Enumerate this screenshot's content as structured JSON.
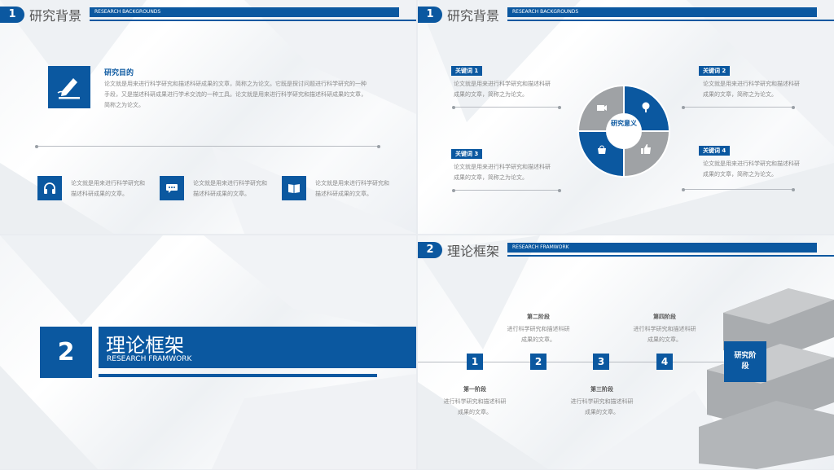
{
  "colors": {
    "accent": "#0b58a0",
    "gray": "#9fa2a5"
  },
  "slide1": {
    "num": "1",
    "title": "研究背景",
    "banner": "RESEARCH BACKGROUNDS",
    "heading": "研究目的",
    "body": "论文就是用来进行科学研究和描述科研成果的文章，简称之为论文。它既是探讨问题进行科学研究的一种手段，又是描述科研成果进行学术交流的一种工具。论文就是用来进行科学研究和描述科研成果的文章，简称之为论文。",
    "items": [
      {
        "icon": "headphones-icon",
        "text": "论文就是用来进行科学研究和描述科研成果的文章。"
      },
      {
        "icon": "chat-icon",
        "text": "论文就是用来进行科学研究和描述科研成果的文章。"
      },
      {
        "icon": "book-icon",
        "text": "论文就是用来进行科学研究和描述科研成果的文章。"
      }
    ]
  },
  "slide2": {
    "num": "1",
    "title": "研究背景",
    "banner": "RESEARCH BACKGROUNDS",
    "center": "研究意义",
    "keywords": [
      {
        "label": "关键词 1",
        "text": "论文就是用来进行科学研究和描述科研成果的文章，简称之为论文。"
      },
      {
        "label": "关键词 2",
        "text": "论文就是用来进行科学研究和描述科研成果的文章，简称之为论文。"
      },
      {
        "label": "关键词 3",
        "text": "论文就是用来进行科学研究和描述科研成果的文章，简称之为论文。"
      },
      {
        "label": "关键词 4",
        "text": "论文就是用来进行科学研究和描述科研成果的文章，简称之为论文。"
      }
    ]
  },
  "slide3": {
    "num": "2",
    "title": "理论框架",
    "subtitle": "RESEARCH FRAMWORK"
  },
  "slide4": {
    "num": "2",
    "title": "理论框架",
    "banner": "RESEARCH FRAMWORK",
    "steps": [
      {
        "n": "1",
        "label": "第一阶段",
        "text": "进行科学研究和描述科研成果的文章。"
      },
      {
        "n": "2",
        "label": "第二阶段",
        "text": "进行科学研究和描述科研成果的文章。"
      },
      {
        "n": "3",
        "label": "第三阶段",
        "text": "进行科学研究和描述科研成果的文章。"
      },
      {
        "n": "4",
        "label": "第四阶段",
        "text": "进行科学研究和描述科研成果的文章。"
      }
    ],
    "end": "研究阶段"
  }
}
